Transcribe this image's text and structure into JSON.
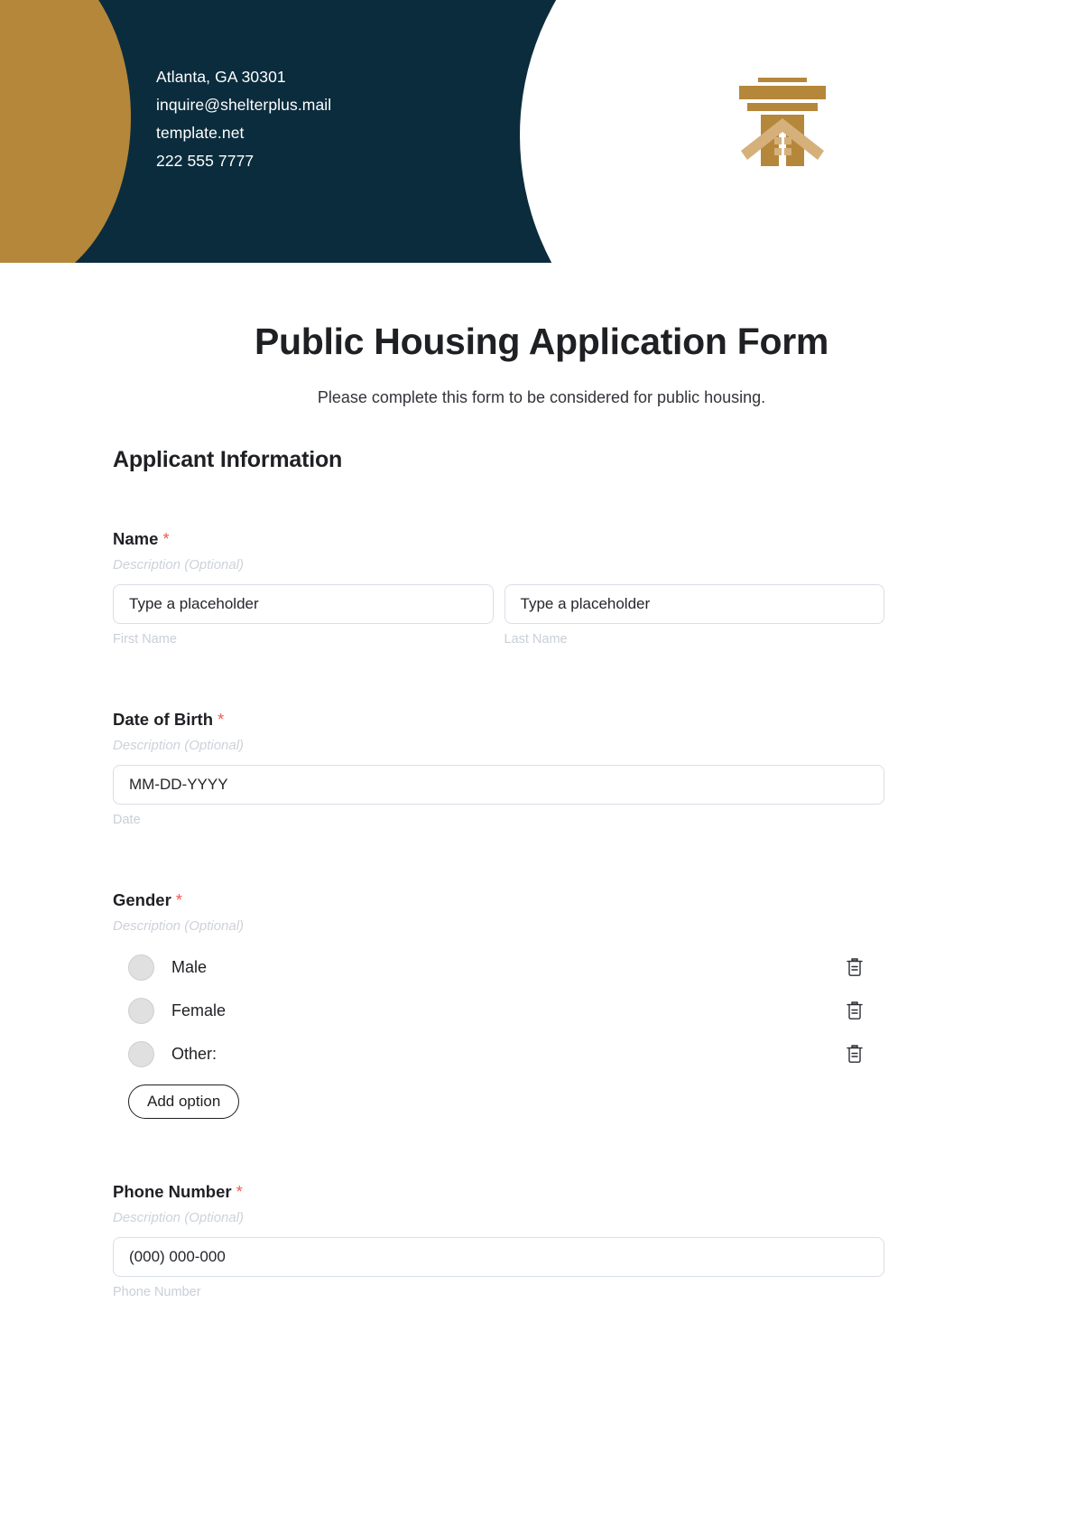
{
  "header": {
    "contact_lines": [
      "Atlanta, GA 30301",
      "inquire@shelterplus.mail",
      "template.net",
      "222 555 7777"
    ],
    "logo_name": "shelter-temple-logo",
    "colors": {
      "navy": "#0b2c3d",
      "gold": "#b5873b",
      "gold_light": "#d5b07a"
    }
  },
  "page": {
    "title": "Public Housing Application Form",
    "subtitle": "Please complete this form to be considered for public housing."
  },
  "form": {
    "section_title": "Applicant Information",
    "description_placeholder": "Description (Optional)",
    "required_marker": "*",
    "required_color": "#f2594b",
    "fields": {
      "name": {
        "label": "Name",
        "description": "Description (Optional)",
        "first": {
          "placeholder": "Type a placeholder",
          "sub_label": "First Name"
        },
        "last": {
          "placeholder": "Type a placeholder",
          "sub_label": "Last Name"
        }
      },
      "dob": {
        "label": "Date of Birth",
        "description": "Description (Optional)",
        "placeholder": "MM-DD-YYYY",
        "sub_label": "Date"
      },
      "gender": {
        "label": "Gender",
        "description": "Description (Optional)",
        "options": [
          {
            "label": "Male"
          },
          {
            "label": "Female"
          },
          {
            "label": "Other:"
          }
        ],
        "add_option_label": "Add option"
      },
      "phone": {
        "label": "Phone Number",
        "description": "Description (Optional)",
        "placeholder": "(000) 000-000",
        "sub_label": "Phone Number"
      }
    }
  }
}
